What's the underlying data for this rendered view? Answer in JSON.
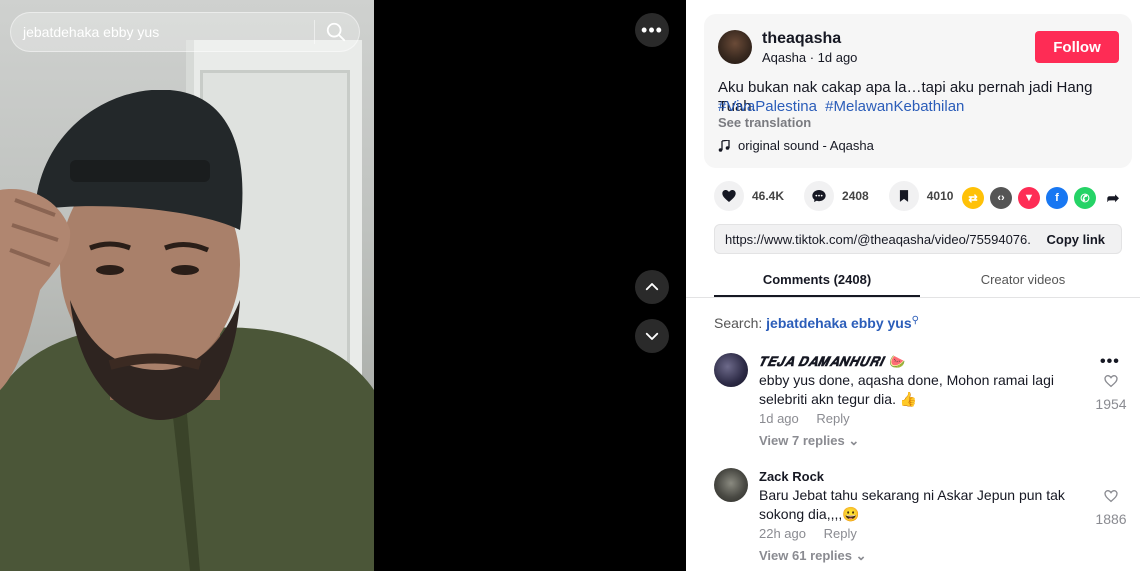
{
  "search": {
    "query": "jebatdehaka ebby yus"
  },
  "video": {
    "more_label": "•••"
  },
  "author": {
    "username": "theaqasha",
    "display_name": "Aqasha",
    "posted": "1d ago",
    "subline": "Aqasha · 1d ago",
    "follow_label": "Follow"
  },
  "post": {
    "caption": "Aku bukan nak cakap apa la…tapi aku pernah jadi Hang Tuah.",
    "hashtags": [
      "#VivaPalestina",
      "#MelawanKebathilan"
    ],
    "see_translation": "See translation",
    "sound": "original sound - Aqasha"
  },
  "stats": {
    "likes": "46.4K",
    "comments": "2408",
    "saves": "4010"
  },
  "share": {
    "url": "https://www.tiktok.com/@theaqasha/video/75594076...",
    "copy_label": "Copy link"
  },
  "tabs": [
    {
      "label": "Comments (2408)",
      "active": true
    },
    {
      "label": "Creator videos",
      "active": false
    }
  ],
  "comment_search": {
    "prefix": "Search: ",
    "term": "jebatdehaka ebby yus"
  },
  "comments": [
    {
      "name": "𝑻𝑬𝑱𝑨 𝑫𝑨𝑴𝑨𝑵𝑯𝑼𝑹𝑰 🍉",
      "text": "ebby yus done, aqasha done, Mohon ramai lagi selebriti akn tegur dia. 👍",
      "time": "1d ago",
      "reply": "Reply",
      "view_replies": "View 7 replies",
      "likes": "1954"
    },
    {
      "name": "Zack Rock",
      "text": "Baru Jebat tahu sekarang ni Askar Jepun pun tak sokong dia,,,,😀",
      "time": "22h ago",
      "reply": "Reply",
      "view_replies": "View 61 replies",
      "likes": "1886"
    }
  ],
  "colors": {
    "follow": "#fe2c55",
    "hashtag": "#2b5db9"
  }
}
